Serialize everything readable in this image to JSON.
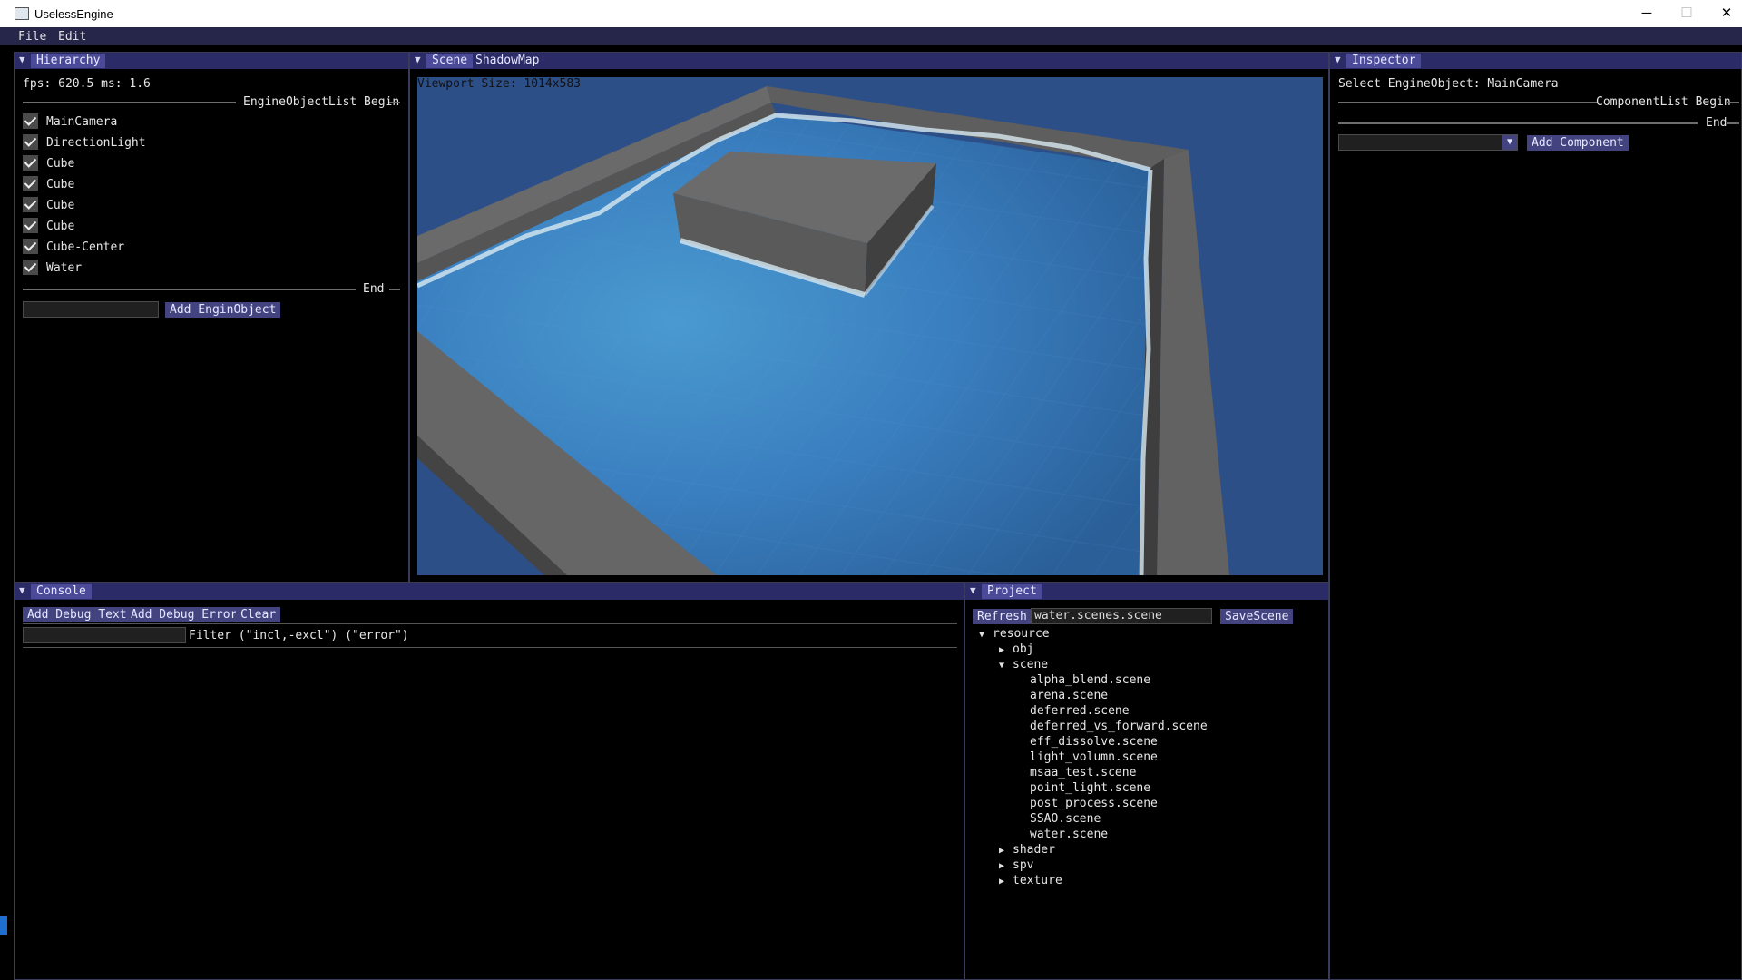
{
  "window": {
    "title": "UselessEngine",
    "minimize": "─",
    "maximize": "☐",
    "close": "✕"
  },
  "menu": [
    "File",
    "Edit"
  ],
  "hierarchy": {
    "title": "Hierarchy",
    "stats": "fps: 620.5 ms: 1.6",
    "list_begin": "EngineObjectList Begin",
    "list_end": "End",
    "objects": [
      "MainCamera",
      "DirectionLight",
      "Cube",
      "Cube",
      "Cube",
      "Cube",
      "Cube-Center",
      "Water"
    ],
    "new_object_value": "",
    "add_button": "Add EnginObject"
  },
  "scene": {
    "tabs": [
      "Scene",
      "ShadowMap"
    ],
    "viewport_label": "Viewport Size: 1014x583"
  },
  "inspector": {
    "title": "Inspector",
    "selected": "Select EngineObject: MainCamera",
    "list_begin": "ComponentList Begin",
    "list_end": "End",
    "component_select": "",
    "add_button": "Add Component"
  },
  "console": {
    "title": "Console",
    "buttons": [
      "Add Debug Text",
      "Add Debug Error",
      "Clear"
    ],
    "filter_value": "",
    "filter_label": "Filter (\"incl,-excl\") (\"error\")"
  },
  "project": {
    "title": "Project",
    "refresh": "Refresh",
    "scene_name": "water.scenes.scene",
    "save": "SaveScene",
    "tree": {
      "root": "resource",
      "folders_before": [
        "obj"
      ],
      "open_folder": "scene",
      "files": [
        "alpha_blend.scene",
        "arena.scene",
        "deferred.scene",
        "deferred_vs_forward.scene",
        "eff_dissolve.scene",
        "light_volumn.scene",
        "msaa_test.scene",
        "point_light.scene",
        "post_process.scene",
        "SSAO.scene",
        "water.scene"
      ],
      "folders_after": [
        "shader",
        "spv",
        "texture"
      ]
    }
  }
}
